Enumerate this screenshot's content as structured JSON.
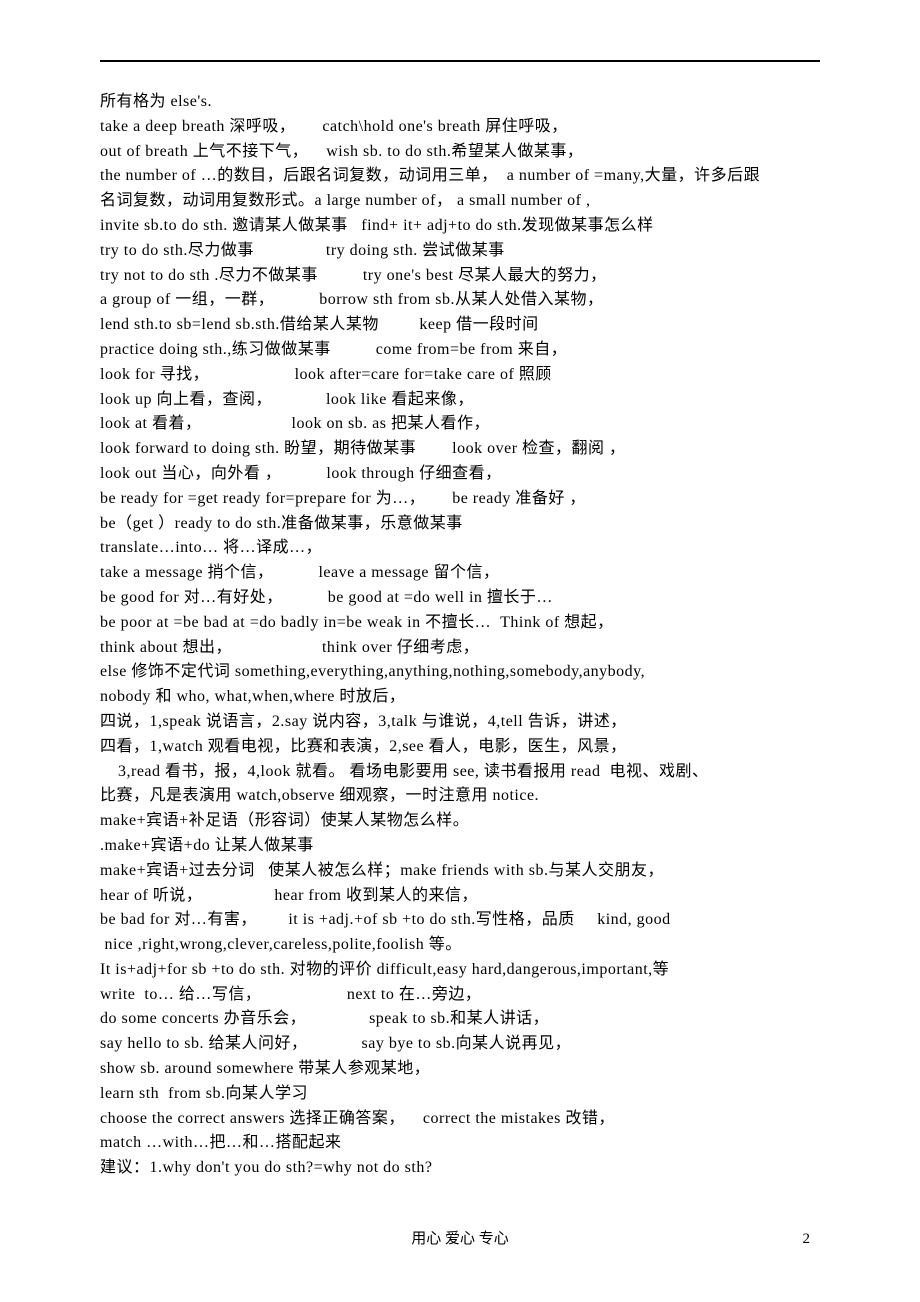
{
  "lines": [
    "所有格为 else's.",
    "take a deep breath 深呼吸，      catch\\hold one's breath 屏住呼吸，",
    "out of breath 上气不接下气，    wish sb. to do sth.希望某人做某事，",
    "the number of …的数目，后跟名词复数，动词用三单，  a number of =many,大量，许多后跟",
    "名词复数，动词用复数形式。a large number of， a small number of ,",
    "invite sb.to do sth. 邀请某人做某事   find+ it+ adj+to do sth.发现做某事怎么样",
    "try to do sth.尽力做事                try doing sth. 尝试做某事",
    "try not to do sth .尽力不做某事          try one's best 尽某人最大的努力，",
    "a group of 一组，一群，          borrow sth from sb.从某人处借入某物，",
    "lend sth.to sb=lend sb.sth.借给某人某物         keep 借一段时间",
    "practice doing sth.,练习做做某事          come from=be from 来自，",
    "look for 寻找，                   look after=care for=take care of 照顾",
    "look up 向上看，查阅，            look like 看起来像，",
    "look at 看着，                    look on sb. as 把某人看作，",
    "look forward to doing sth. 盼望，期待做某事        look over 检查，翻阅 ，",
    "look out 当心，向外看 ，          look through 仔细查看，",
    "be ready for =get ready for=prepare for 为…，      be ready 准备好 ，",
    "be（get ）ready to do sth.准备做某事，乐意做某事",
    "translate…into… 将…译成…，",
    "take a message 捎个信，          leave a message 留个信，",
    "be good for 对…有好处，          be good at =do well in 擅长于…",
    "be poor at =be bad at =do badly in=be weak in 不擅长…  Think of 想起，",
    "think about 想出，                    think over 仔细考虑，",
    "else 修饰不定代词 something,everything,anything,nothing,somebody,anybody,",
    "nobody 和 who, what,when,where 时放后，",
    "四说，1,speak 说语言，2.say 说内容，3,talk 与谁说，4,tell 告诉，讲述，",
    "四看，1,watch 观看电视，比赛和表演，2,see 看人，电影，医生，风景，",
    "    3,read 看书，报，4,look 就看。 看场电影要用 see, 读书看报用 read  电视、戏剧、",
    "比赛，凡是表演用 watch,observe 细观察，一时注意用 notice.",
    "make+宾语+补足语（形容词）使某人某物怎么样。",
    ".make+宾语+do 让某人做某事",
    "make+宾语+过去分词   使某人被怎么样；make friends with sb.与某人交朋友，",
    "hear of 听说，                hear from 收到某人的来信，",
    "be bad for 对…有害，       it is +adj.+of sb +to do sth.写性格，品质     kind, good",
    " nice ,right,wrong,clever,careless,polite,foolish 等。",
    "It is+adj+for sb +to do sth. 对物的评价 difficult,easy hard,dangerous,important,等",
    "write  to… 给…写信，                   next to 在…旁边，",
    "do some concerts 办音乐会，              speak to sb.和某人讲话，",
    "say hello to sb. 给某人问好，            say bye to sb.向某人说再见，",
    "show sb. around somewhere 带某人参观某地，",
    "learn sth  from sb.向某人学习",
    "choose the correct answers 选择正确答案，    correct the mistakes 改错，",
    "match …with…把…和…搭配起来",
    "建议：1.why don't you do sth?=why not do sth?"
  ],
  "footer": {
    "center": "用心    爱心    专心",
    "page": "2"
  }
}
